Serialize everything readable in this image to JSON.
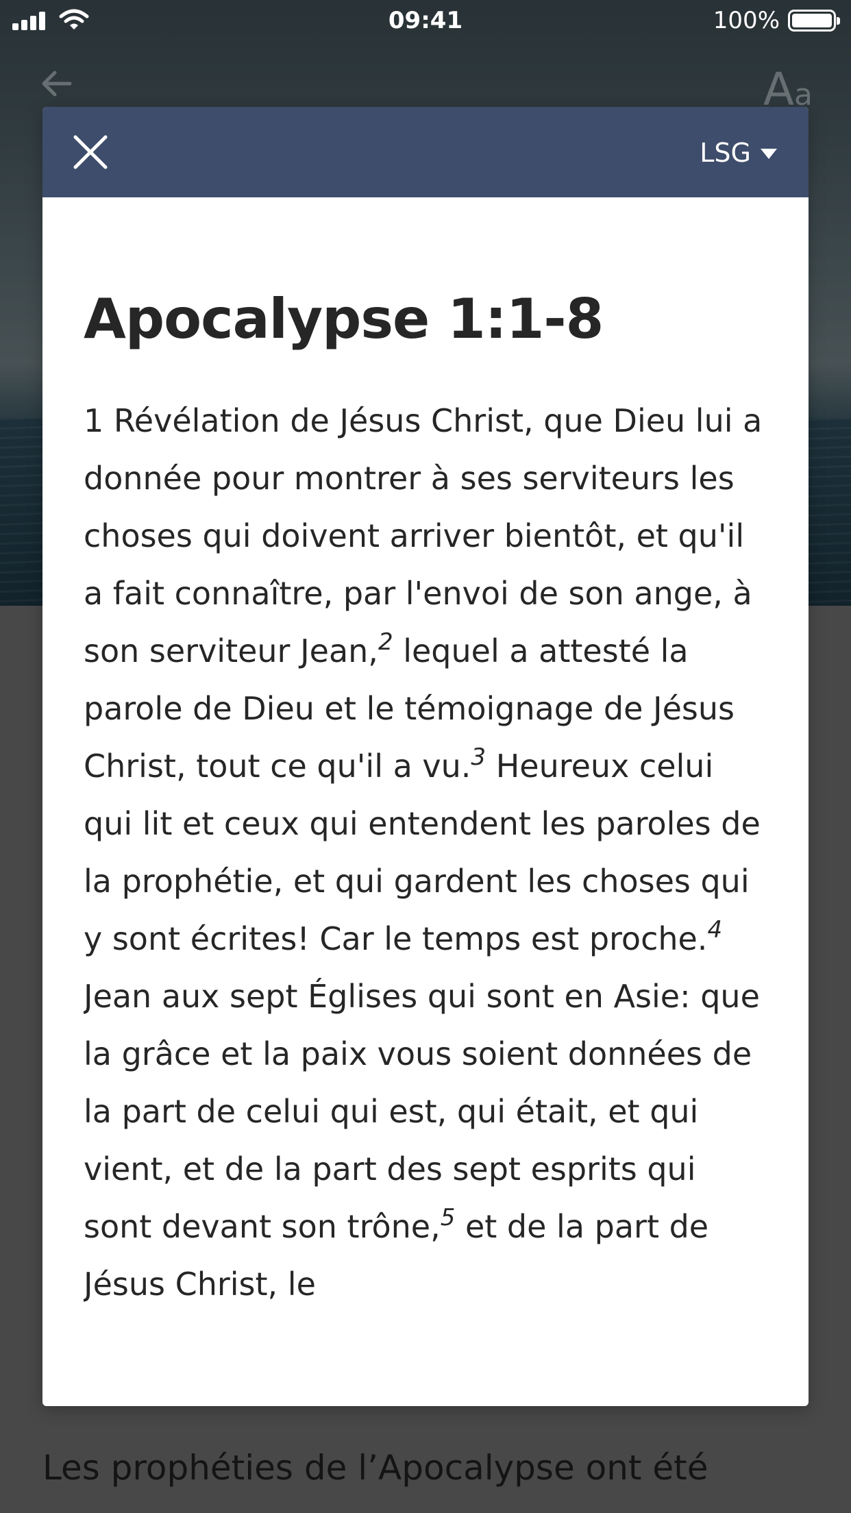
{
  "status_bar": {
    "time": "09:41",
    "battery": "100%"
  },
  "background": {
    "font_size_label_big": "A",
    "font_size_label_small": "a",
    "body_text_line1": "Les prophéties de l’Apocalypse ont été"
  },
  "modal": {
    "version": "LSG",
    "passage_title": "Apocalypse 1:1-8",
    "verses": [
      {
        "num": "1",
        "text": "Révélation de Jésus Christ, que Dieu lui a donnée pour montrer à ses serviteurs les choses qui doivent arriver bientôt, et qu'il a fait connaître, par l'envoi de son ange, à son serviteur Jean,"
      },
      {
        "num": "2",
        "text": "lequel a attesté la parole de Dieu et le témoignage de Jésus Christ, tout ce qu'il a vu."
      },
      {
        "num": "3",
        "text": "Heureux celui qui lit et ceux qui entendent les paroles de la prophétie, et qui gardent les choses qui y sont écrites! Car le temps est proche."
      },
      {
        "num": "4",
        "text": "Jean aux sept Églises qui sont en Asie: que la grâce et la paix vous soient données de la part de celui qui est, qui était, et qui vient, et de la part des sept esprits qui sont devant son trône,"
      },
      {
        "num": "5",
        "text": "et de la part de Jésus Christ, le"
      }
    ]
  }
}
